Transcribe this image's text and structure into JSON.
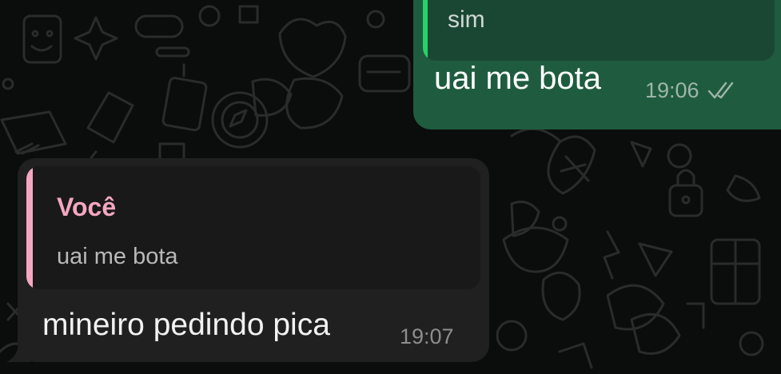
{
  "wallpaper": {
    "background_color": "#0b0c0c",
    "doodle_color": "#2a2b2b"
  },
  "messages": [
    {
      "direction": "outgoing",
      "bubble_color": "#1f5c3f",
      "quote": {
        "text": "sim",
        "bar_color": "#25d366"
      },
      "text": "uai me bota",
      "time": "19:06",
      "status_icon": "double-check-read-icon"
    },
    {
      "direction": "incoming",
      "bubble_color": "#202020",
      "quote": {
        "author": "Você",
        "text": "uai me bota",
        "bar_color": "#f4a7c1"
      },
      "text": "mineiro pedindo pica",
      "time": "19:07"
    }
  ]
}
